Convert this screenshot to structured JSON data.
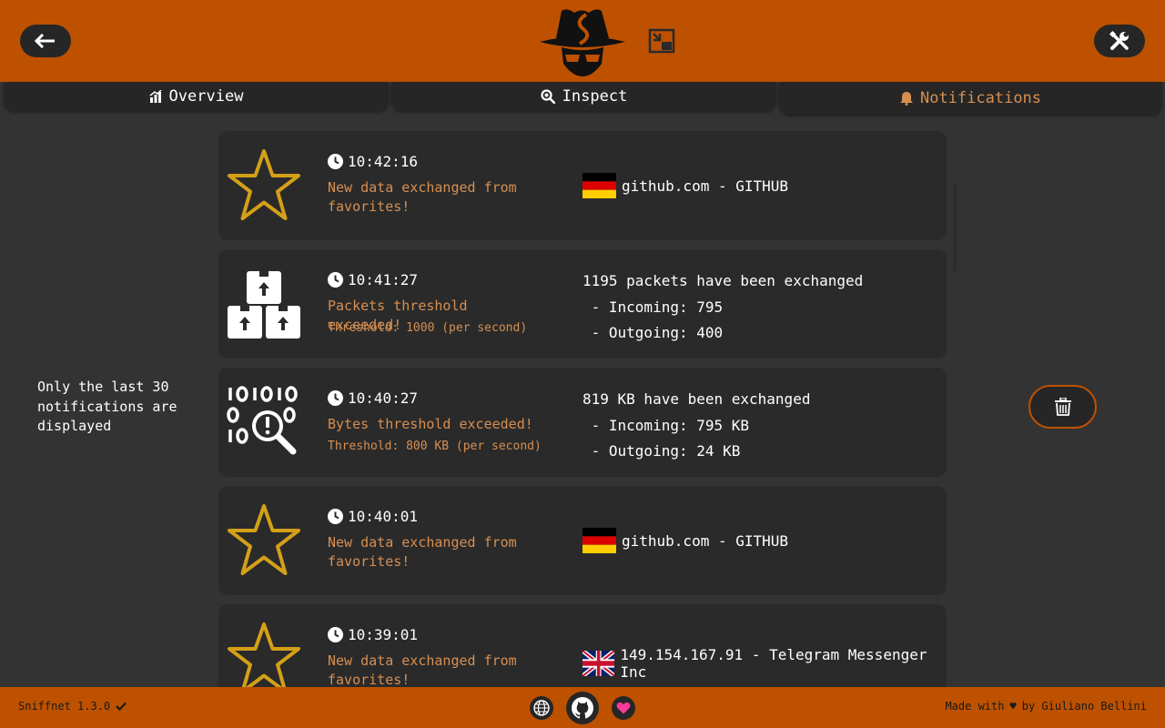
{
  "colors": {
    "accent": "#bd5100",
    "accent_text": "#d68f52",
    "background": "#333333",
    "card": "#2a2a2a",
    "button": "#262626",
    "star": "#d4a017"
  },
  "header": {
    "back_icon": "arrow-left-icon",
    "logo_icon": "sniffnet-spy-logo",
    "thumbnail_icon": "picture-in-picture-icon",
    "settings_icon": "wrench-screwdriver-icon"
  },
  "tabs": [
    {
      "label": "Overview",
      "icon": "chart-icon"
    },
    {
      "label": "Inspect",
      "icon": "magnifier-icon"
    },
    {
      "label": "Notifications",
      "icon": "bell-icon",
      "active": true
    }
  ],
  "note": "Only the last 30 notifications are displayed",
  "notifications": [
    {
      "kind": "favorite",
      "icon": "star-icon",
      "time": "10:42:16",
      "title": "New data exchanged from favorites!",
      "flag": "DE",
      "host": "github.com - GITHUB"
    },
    {
      "kind": "packets",
      "icon": "packages-icon",
      "time": "10:41:27",
      "title": "Packets threshold exceeded!",
      "threshold": "Threshold: 1000 (per second)",
      "details": [
        "1195 packets have been exchanged",
        " - Incoming: 795",
        " - Outgoing: 400"
      ]
    },
    {
      "kind": "bytes",
      "icon": "binary-search-icon",
      "time": "10:40:27",
      "title": "Bytes threshold exceeded!",
      "threshold": "Threshold: 800 KB (per second)",
      "details": [
        "819 KB have been exchanged",
        " - Incoming: 795 KB",
        " - Outgoing: 24 KB"
      ]
    },
    {
      "kind": "favorite",
      "icon": "star-icon",
      "time": "10:40:01",
      "title": "New data exchanged from favorites!",
      "flag": "DE",
      "host": "github.com - GITHUB"
    },
    {
      "kind": "favorite",
      "icon": "star-icon",
      "time": "10:39:01",
      "title": "New data exchanged from favorites!",
      "flag": "GB",
      "host": "149.154.167.91 - Telegram Messenger Inc"
    }
  ],
  "trash_icon": "trash-icon",
  "footer": {
    "version": "Sniffnet 1.3.0",
    "version_icon": "checkmark-icon",
    "made_prefix": "Made with",
    "made_heart": "♥",
    "made_suffix": "by Giuliano Bellini",
    "links": [
      {
        "icon": "globe-icon"
      },
      {
        "icon": "github-icon"
      },
      {
        "icon": "heart-icon"
      }
    ]
  }
}
